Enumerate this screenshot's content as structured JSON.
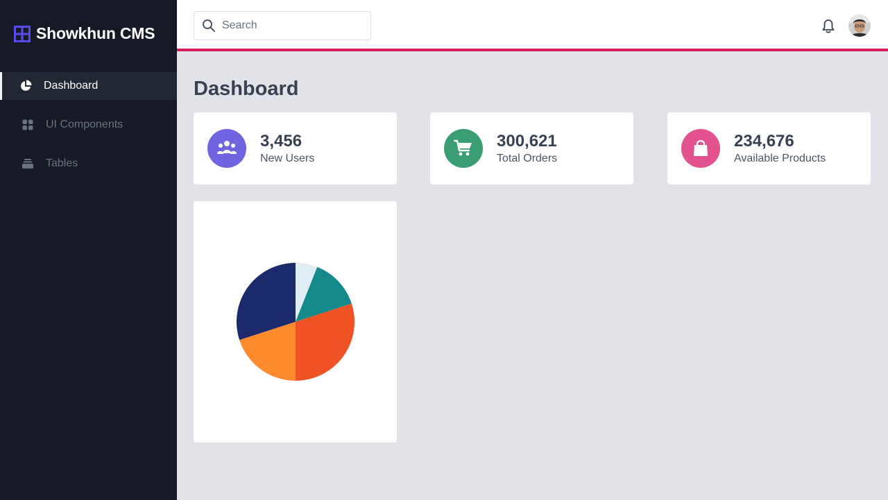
{
  "app": {
    "title": "Showkhun CMS"
  },
  "sidebar": {
    "items": [
      {
        "label": "Dashboard",
        "icon": "pie-chart-icon",
        "active": true
      },
      {
        "label": "UI Components",
        "icon": "grid-icon",
        "active": false
      },
      {
        "label": "Tables",
        "icon": "table-icon",
        "active": false
      }
    ]
  },
  "topbar": {
    "search_placeholder": "Search",
    "search_value": "",
    "notification_icon": "bell-icon",
    "avatar_icon": "user-avatar"
  },
  "page": {
    "title": "Dashboard"
  },
  "stats": [
    {
      "value": "3,456",
      "label": "New Users",
      "icon": "users-icon",
      "color": "#7164e0"
    },
    {
      "value": "300,621",
      "label": "Total Orders",
      "icon": "cart-icon",
      "color": "#3a9e74"
    },
    {
      "value": "234,676",
      "label": "Available Products",
      "icon": "shopping-bag-icon",
      "color": "#e2528e"
    }
  ],
  "colors": {
    "sidebar_bg": "#151a25",
    "accent": "#d81b60",
    "brand_icon": "#5b4bea",
    "page_bg": "#e2e3e8"
  },
  "chart_data": {
    "type": "pie",
    "title": "",
    "series": [
      {
        "value": 6,
        "color": "#e0edf5"
      },
      {
        "value": 14,
        "color": "#14898c"
      },
      {
        "value": 30,
        "color": "#ef5324"
      },
      {
        "value": 20,
        "color": "#ff8b2d"
      },
      {
        "value": 30,
        "color": "#1b2a6b"
      }
    ]
  }
}
